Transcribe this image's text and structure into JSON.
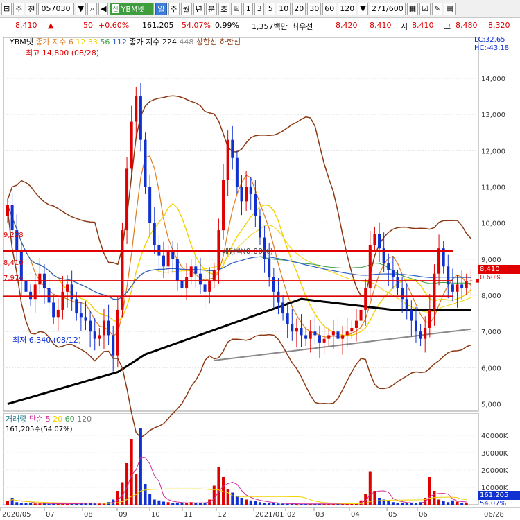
{
  "toolbar": {
    "btn_settings": "⊟",
    "btn_ju": "주",
    "btn_jeon": "전",
    "code": "057030",
    "name_tag": "신",
    "name": "YBM넷",
    "periods": [
      "일",
      "주",
      "월",
      "년",
      "분",
      "초",
      "틱"
    ],
    "minutes": [
      "1",
      "3",
      "5",
      "10",
      "20",
      "30",
      "60",
      "120"
    ],
    "count": "271",
    "count_total": "/600",
    "selected_period": "일"
  },
  "quote": {
    "price": "8,410",
    "arrow": "▲",
    "change": "50",
    "change_pct": "+0.60%",
    "volume": "161,205",
    "vol_ratio": "54.07%",
    "turnover": "0.99%",
    "amount": "1,357백만",
    "pref_label": "최우선",
    "bid": "8,420",
    "ask": "8,410",
    "open_label": "시",
    "open": "8,410",
    "high_label": "고",
    "high": "8,480",
    "low_cut": "8,320"
  },
  "colors": {
    "up": "#e00000",
    "down": "#1030d0",
    "ma5": "#e07a1f",
    "ma12": "#f2d200",
    "ma33": "#f2d200",
    "ma56": "#3aa04a",
    "ma112": "#2f62c6",
    "ma224": "#000000",
    "ma448": "#8a8a8a",
    "bollinger": "#8b3a14",
    "support": "#e00000"
  },
  "chart_data": {
    "type": "candlestick",
    "symbol": "YBM넷",
    "price_axis": {
      "ticks": [
        5000,
        6000,
        7000,
        8000,
        9000,
        10000,
        11000,
        12000,
        13000,
        14000
      ],
      "tick_labels": [
        "5,000",
        "6,000",
        "7,000",
        "8,000",
        "9,000",
        "10,000",
        "11,000",
        "12,000",
        "13,000",
        "14,000"
      ],
      "range": [
        4800,
        14900
      ]
    },
    "time_axis": {
      "labels": [
        "2020/05",
        "07",
        "08",
        "09",
        "10",
        "11",
        "12",
        "2021/01",
        "02",
        "03",
        "04",
        "05",
        "06",
        "06/28"
      ]
    },
    "legend": {
      "main": [
        "YBM넷",
        "종가 지수 6",
        "12",
        "33",
        "56",
        "112",
        "종가 지수 224",
        "448",
        "상한선",
        "하한선"
      ],
      "volume": [
        "거래량",
        "단순 5",
        "20",
        "60",
        "120"
      ]
    },
    "lc_label": "LC:32.65",
    "hc_label": "HC:-43.18",
    "max_label": "최고 14,800 (08/28)",
    "min_label": "최저 6,340 (08/12)",
    "dividend_label": "배당락(0.00%)",
    "level_labels": [
      "9,228",
      "8,410",
      "7,974"
    ],
    "current_price_label": "8,410",
    "current_pct_label": "0.60%",
    "levels": [
      9228,
      8410,
      7974
    ],
    "close_series": [
      10500,
      9800,
      9200,
      8400,
      8100,
      7900,
      8300,
      8600,
      8200,
      7800,
      7400,
      7600,
      8100,
      8300,
      7900,
      7500,
      7400,
      7300,
      7000,
      6800,
      6900,
      7300,
      6900,
      6340,
      7600,
      9800,
      11500,
      12800,
      13500,
      12300,
      11000,
      10000,
      9400,
      9100,
      8800,
      9200,
      9000,
      8400,
      8200,
      8500,
      8800,
      8600,
      8300,
      8100,
      8400,
      8700,
      9800,
      11200,
      12300,
      11800,
      11000,
      10600,
      11000,
      10800,
      10200,
      9600,
      9000,
      8500,
      8100,
      7800,
      7500,
      7200,
      7000,
      7100,
      6900,
      6800,
      7000,
      6900,
      6700,
      6800,
      6900,
      7000,
      6800,
      6900,
      7000,
      7100,
      7300,
      7600,
      8200,
      9400,
      9700,
      9300,
      8900,
      8700,
      8500,
      8200,
      7900,
      7600,
      7300,
      7000,
      6800,
      7100,
      7600,
      8600,
      9300,
      8800,
      8300,
      8100,
      8300,
      8200,
      8400,
      8410
    ],
    "volume_axis": {
      "ticks": [
        10000,
        20000,
        30000,
        40000
      ],
      "tick_labels": [
        "10000K",
        "20000K",
        "30000K",
        "40000K"
      ],
      "range": [
        0,
        48000
      ]
    },
    "volume_label": "161,205주(54.07%)",
    "volume_current": "161,205",
    "volume_pct": "54.07%",
    "volume_series": [
      2000,
      4000,
      1500,
      1200,
      800,
      900,
      700,
      600,
      800,
      500,
      700,
      400,
      600,
      500,
      700,
      800,
      1000,
      900,
      1200,
      700,
      600,
      900,
      1500,
      3000,
      8000,
      13000,
      24000,
      38000,
      18000,
      44000,
      12000,
      6000,
      3000,
      2500,
      1800,
      1500,
      1200,
      1000,
      900,
      800,
      1500,
      1200,
      1000,
      900,
      3000,
      11000,
      22000,
      16000,
      9000,
      7000,
      5000,
      4000,
      3000,
      2500,
      2000,
      1500,
      1200,
      1000,
      800,
      700,
      600,
      500,
      600,
      400,
      500,
      400,
      600,
      500,
      400,
      500,
      600,
      400,
      500,
      600,
      700,
      900,
      1200,
      2500,
      6000,
      19000,
      8000,
      4000,
      3000,
      2000,
      1500,
      1200,
      1000,
      900,
      800,
      1000,
      1500,
      4000,
      16000,
      8000,
      3000,
      2000,
      1500,
      2500,
      1800,
      1200,
      1000
    ]
  }
}
